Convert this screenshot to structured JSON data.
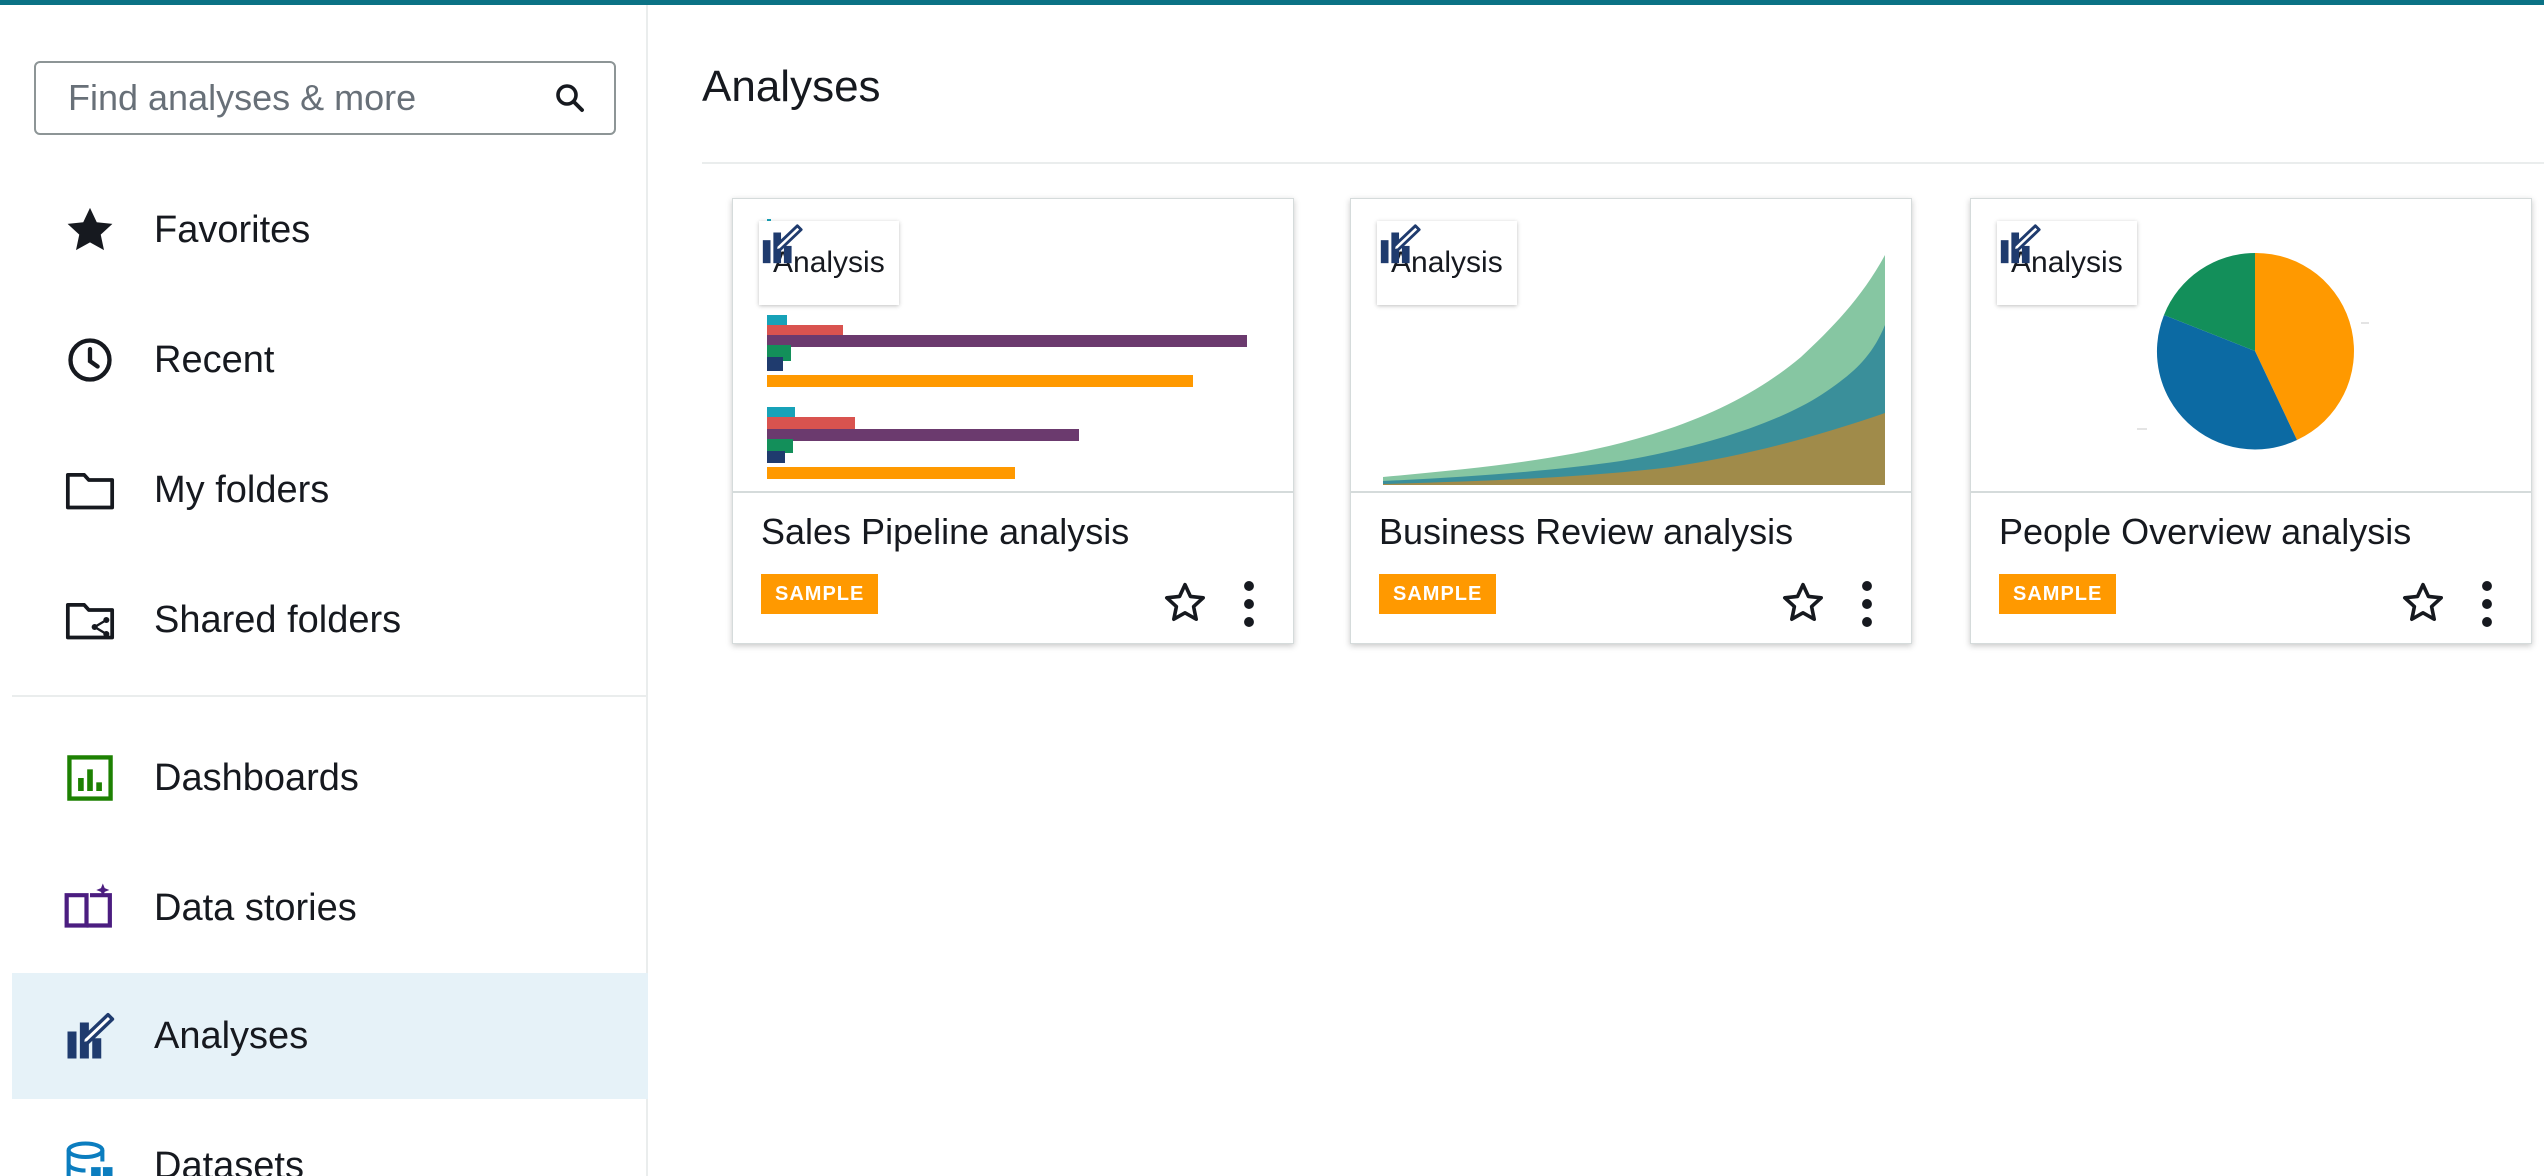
{
  "search": {
    "placeholder": "Find analyses & more"
  },
  "sidebar": {
    "items": [
      {
        "label": "Favorites",
        "icon": "star-icon"
      },
      {
        "label": "Recent",
        "icon": "clock-icon"
      },
      {
        "label": "My folders",
        "icon": "folder-icon"
      },
      {
        "label": "Shared folders",
        "icon": "shared-folder-icon"
      },
      {
        "label": "Dashboards",
        "icon": "dashboard-icon"
      },
      {
        "label": "Data stories",
        "icon": "data-story-icon"
      },
      {
        "label": "Analyses",
        "icon": "analysis-icon",
        "active": true
      },
      {
        "label": "Datasets",
        "icon": "dataset-icon"
      }
    ]
  },
  "main": {
    "title": "Analyses",
    "cards": [
      {
        "title": "Sales Pipeline analysis",
        "type_label": "Analysis",
        "badge": "SAMPLE",
        "thumbnail": "bar-chart"
      },
      {
        "title": "Business Review analysis",
        "type_label": "Analysis",
        "badge": "SAMPLE",
        "thumbnail": "area-chart"
      },
      {
        "title": "People Overview analysis",
        "type_label": "Analysis",
        "badge": "SAMPLE",
        "thumbnail": "pie-chart"
      }
    ]
  },
  "colors": {
    "accent": "#0b7285",
    "active_bg": "#e6f2f8",
    "sample_badge": "#ff9900",
    "chart_orange": "#ff9900",
    "chart_purple": "#6b3a6e",
    "chart_red": "#d9534f",
    "chart_teal": "#17a2b8",
    "chart_green": "#138f5a",
    "chart_blue": "#0c6aa3"
  }
}
